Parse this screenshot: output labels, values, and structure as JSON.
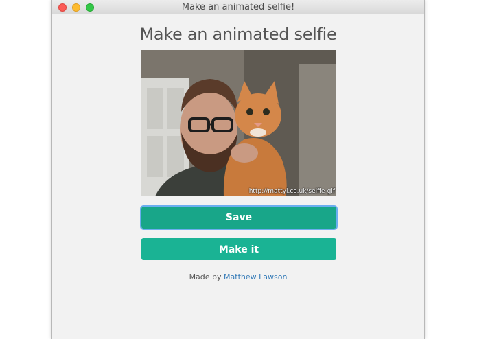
{
  "window": {
    "title": "Make an animated selfie!"
  },
  "page": {
    "heading": "Make an animated selfie"
  },
  "preview": {
    "watermark": "http://mattyl.co.uk/selfie-gif"
  },
  "buttons": {
    "save_label": "Save",
    "make_label": "Make it"
  },
  "footer": {
    "prefix": "Made by",
    "author": "Matthew Lawson"
  },
  "colors": {
    "save_button": "#18a689",
    "make_button": "#1ab394",
    "focus_ring": "#6aaef0",
    "link": "#337ab7"
  }
}
